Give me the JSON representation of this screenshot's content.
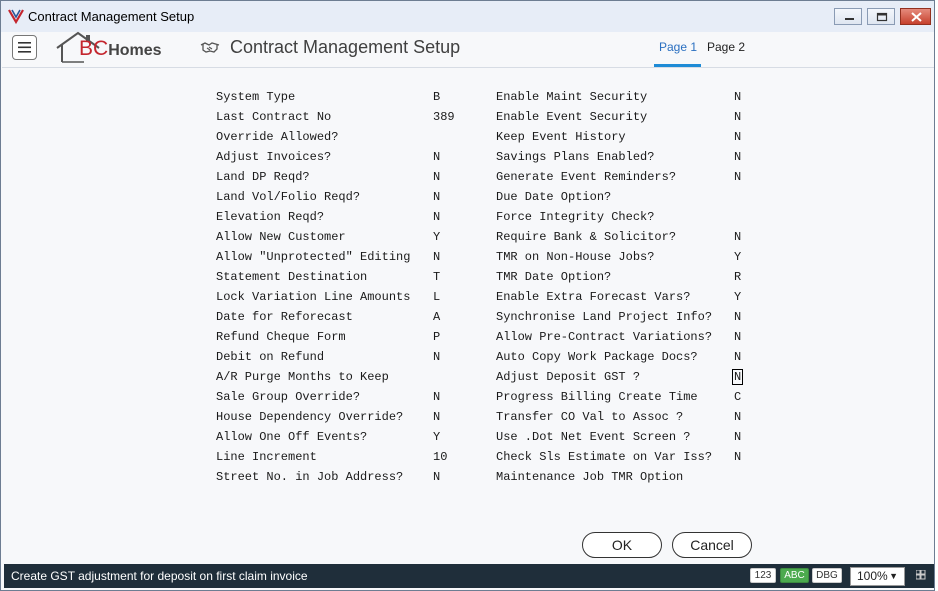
{
  "window": {
    "title": "Contract Management Setup"
  },
  "header": {
    "logo": {
      "bc": "BC",
      "homes": "Homes"
    },
    "page_title": "Contract Management Setup",
    "tabs": [
      {
        "label": "Page 1",
        "active": true
      },
      {
        "label": "Page 2",
        "active": false
      }
    ]
  },
  "settings_left": [
    {
      "label": "System Type",
      "value": "B"
    },
    {
      "label": "Last Contract No",
      "value": "389"
    },
    {
      "label": "Override Allowed?",
      "value": ""
    },
    {
      "label": "Adjust Invoices?",
      "value": "N"
    },
    {
      "label": "Land DP Reqd?",
      "value": "N"
    },
    {
      "label": "Land Vol/Folio Reqd?",
      "value": "N"
    },
    {
      "label": "Elevation Reqd?",
      "value": "N"
    },
    {
      "label": "Allow New Customer",
      "value": "Y"
    },
    {
      "label": "Allow \"Unprotected\" Editing",
      "value": "N"
    },
    {
      "label": "Statement Destination",
      "value": "T"
    },
    {
      "label": "Lock Variation Line Amounts",
      "value": "L"
    },
    {
      "label": "Date for Reforecast",
      "value": "A"
    },
    {
      "label": "Refund Cheque Form",
      "value": "P"
    },
    {
      "label": "Debit on Refund",
      "value": "N"
    },
    {
      "label": "A/R Purge Months to Keep",
      "value": ""
    },
    {
      "label": "Sale Group Override?",
      "value": "N"
    },
    {
      "label": "House Dependency Override?",
      "value": "N"
    },
    {
      "label": "Allow One Off Events?",
      "value": "Y"
    },
    {
      "label": "Line Increment",
      "value": "10"
    },
    {
      "label": "Street No. in Job Address?",
      "value": "N"
    }
  ],
  "settings_right": [
    {
      "label": "Enable Maint Security",
      "value": "N"
    },
    {
      "label": "Enable Event Security",
      "value": "N"
    },
    {
      "label": "Keep Event History",
      "value": "N"
    },
    {
      "label": "Savings Plans Enabled?",
      "value": "N"
    },
    {
      "label": "Generate Event Reminders?",
      "value": "N"
    },
    {
      "label": "Due Date Option?",
      "value": ""
    },
    {
      "label": "Force Integrity Check?",
      "value": ""
    },
    {
      "label": "Require Bank & Solicitor?",
      "value": "N"
    },
    {
      "label": "TMR on Non-House Jobs?",
      "value": "Y"
    },
    {
      "label": "TMR Date Option?",
      "value": "R"
    },
    {
      "label": "Enable Extra Forecast Vars?",
      "value": "Y"
    },
    {
      "label": "Synchronise Land Project Info?",
      "value": "N"
    },
    {
      "label": "Allow Pre-Contract Variations?",
      "value": "N"
    },
    {
      "label": "Auto Copy Work Package Docs?",
      "value": "N"
    },
    {
      "label": "Adjust Deposit GST ?",
      "value": "N",
      "focused": true
    },
    {
      "label": "Progress Billing Create Time",
      "value": "C"
    },
    {
      "label": "Transfer CO Val to Assoc ?",
      "value": "N"
    },
    {
      "label": "Use .Dot Net Event Screen ?",
      "value": "N"
    },
    {
      "label": "Check Sls Estimate on Var Iss?",
      "value": "N"
    },
    {
      "label": "Maintenance Job TMR Option",
      "value": ""
    }
  ],
  "buttons": {
    "ok": "OK",
    "cancel": "Cancel"
  },
  "statusbar": {
    "message": "Create GST adjustment for deposit on first claim invoice",
    "badges": [
      "123",
      "ABC",
      "DBG"
    ],
    "zoom": "100%"
  },
  "colors": {
    "accent": "#1e8bd6",
    "status_bg": "#1f2e3a",
    "abc_badge": "#4caa4e",
    "close_button": "#c6412d"
  },
  "icons": [
    "app-logo-icon",
    "minimize-icon",
    "maximize-icon",
    "close-icon",
    "hamburger-menu-icon",
    "handshake-icon",
    "dropdown-caret-icon",
    "resize-grip-icon"
  ]
}
